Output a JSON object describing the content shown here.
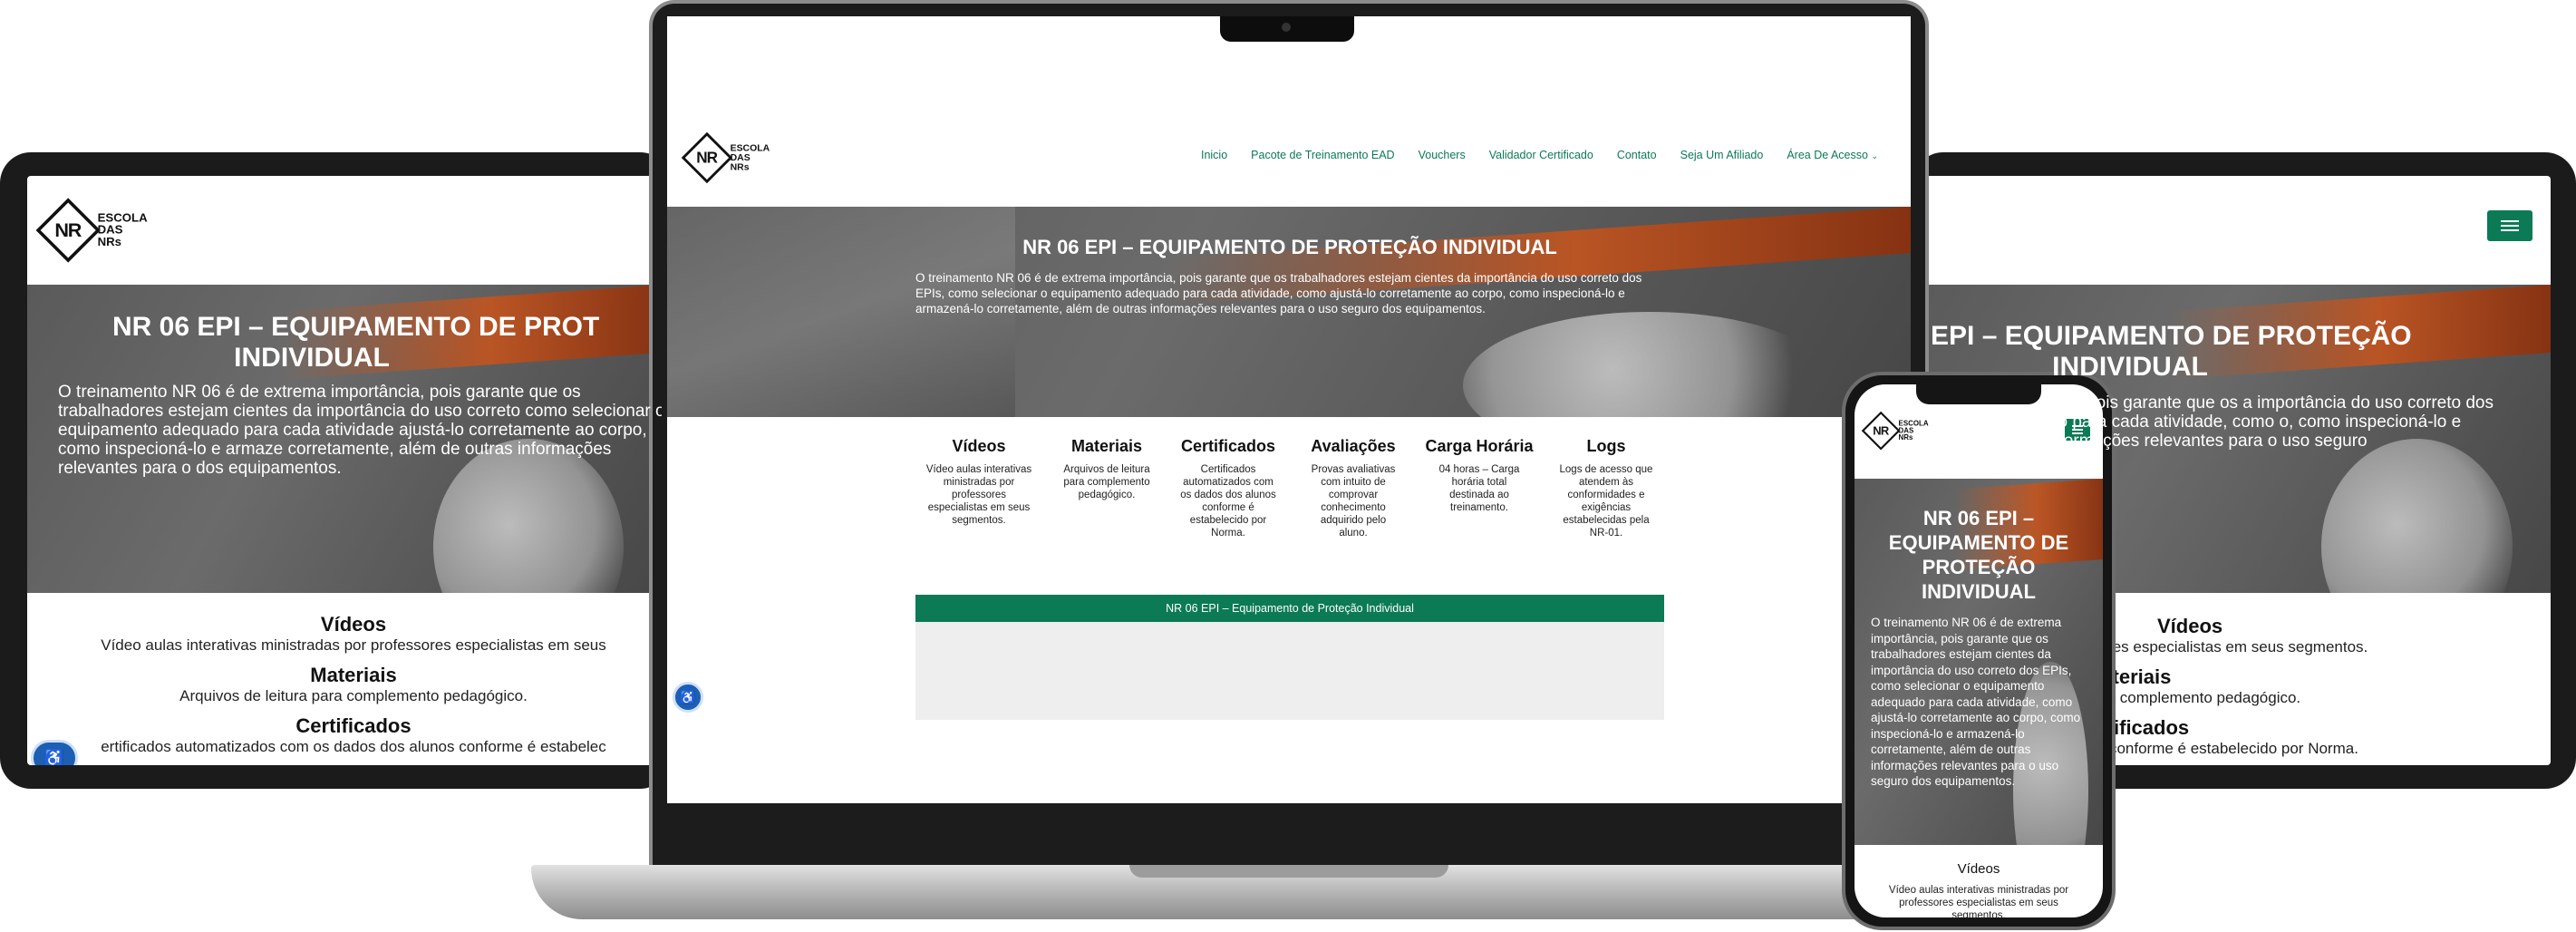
{
  "brand": {
    "logo_mark": "NR",
    "logo_text": [
      "ESCOLA",
      "DAS",
      "NRs"
    ]
  },
  "nav": {
    "items": [
      "Inicio",
      "Pacote de Treinamento EAD",
      "Vouchers",
      "Validador Certificado",
      "Contato",
      "Seja Um Afiliado",
      "Área De Acesso"
    ],
    "dropdown_icon": "chevron-down-icon"
  },
  "hero": {
    "title": "NR 06 EPI – EQUIPAMENTO DE PROTEÇÃO INDIVIDUAL",
    "body": "O treinamento NR 06 é de extrema importância, pois garante que os trabalhadores estejam cientes da importância do uso correto dos EPIs, como selecionar o equipamento adequado para cada atividade, como ajustá-lo corretamente ao corpo, como inspecioná-lo e armazená-lo corretamente, além de outras informações relevantes para o uso seguro dos equipamentos.",
    "tablet_left_title_visible": "NR 06 EPI – EQUIPAMENTO DE PROT",
    "tablet_left_title_line2": "INDIVIDUAL",
    "tablet_left_body": "O treinamento NR 06 é de extrema importância, pois garante que os trabalhadores estejam cientes da importância do uso correto como selecionar o equipamento adequado para cada atividade ajustá-lo corretamente ao corpo, como inspecioná-lo e armaze corretamente, além de outras informações relevantes para o dos equipamentos.",
    "tablet_right_title_visible": "EPI – EQUIPAMENTO DE PROTEÇÃO",
    "tablet_right_title_line2": "INDIVIDUAL",
    "tablet_right_body": "xtrema importância, pois garante que os a importância do uso correto dos EPIs, o adequado para cada atividade, como o, como inspecioná-lo e armazená-lo e informações relevantes para o uso seguro",
    "phone_title": "NR 06 EPI – EQUIPAMENTO DE PROTEÇÃO INDIVIDUAL"
  },
  "features": [
    {
      "title": "Vídeos",
      "desc": "Vídeo aulas interativas ministradas por professores especialistas em seus segmentos."
    },
    {
      "title": "Materiais",
      "desc": "Arquivos de leitura para complemento pedagógico."
    },
    {
      "title": "Certificados",
      "desc": "Certificados automatizados com os dados dos alunos conforme é estabelecido por Norma."
    },
    {
      "title": "Avaliações",
      "desc": "Provas avaliativas com intuito de comprovar conhecimento adquirido pelo aluno."
    },
    {
      "title": "Carga Horária",
      "desc": "04 horas – Carga horária total destinada ao treinamento."
    },
    {
      "title": "Logs",
      "desc": "Logs de acesso que atendem às conformidades e exigências estabelecidas pela NR-01."
    }
  ],
  "tablet_left_features": [
    {
      "title": "Vídeos",
      "desc": "Vídeo aulas interativas ministradas por professores especialistas em seus"
    },
    {
      "title": "Materiais",
      "desc": "Arquivos de leitura para complemento pedagógico."
    },
    {
      "title": "Certificados",
      "desc": "ertificados automatizados com os dados dos alunos conforme é estabelec"
    }
  ],
  "tablet_right_features": [
    {
      "title": "Vídeos",
      "desc": "or professores especialistas em seus segmentos."
    },
    {
      "title": "Materiais",
      "desc": "para complemento pedagógico."
    },
    {
      "title": "Certificados",
      "desc": "dos alunos conforme é estabelecido por Norma."
    }
  ],
  "phone_feature": {
    "title": "Vídeos",
    "desc": "Vídeo aulas interativas ministradas por professores especialistas em seus segmentos."
  },
  "course_bar": {
    "label": "NR 06 EPI – Equipamento de Proteção Individual"
  },
  "colors": {
    "brand_green": "#0b7a55",
    "accessibility_blue": "#1c5fb3",
    "hero_gray": "#5f5f5f"
  }
}
